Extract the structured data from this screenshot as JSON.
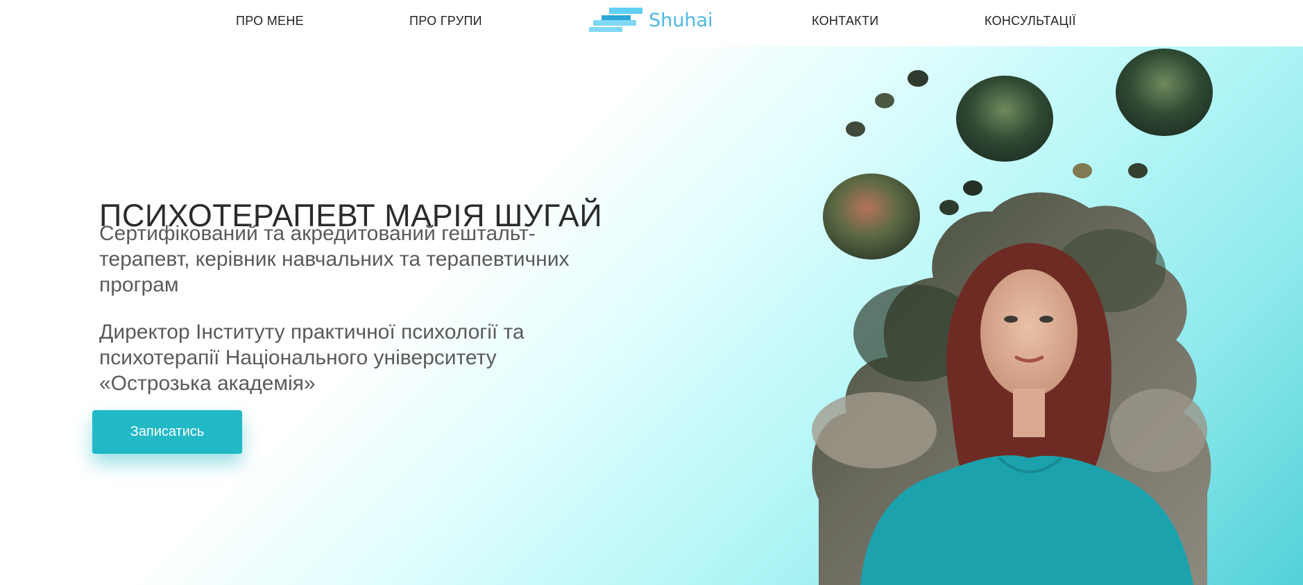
{
  "nav": {
    "items": [
      {
        "label": "ПРО МЕНЕ"
      },
      {
        "label": "ПРО ГРУПИ"
      },
      {
        "label": "КОНТАКТИ"
      },
      {
        "label": "КОНСУЛЬТАЦІЇ"
      }
    ],
    "logo_text": "Shuhai"
  },
  "hero": {
    "title": "ПСИХОТЕРАПЕВТ МАРІЯ ШУГАЙ",
    "lead": "Сертифікований та акредитований гештальт-терапевт, керівник навчальних та терапевтичних програм",
    "lead2": "Директор Інституту практичної психології та психотерапії Національного університету «Острозька академія»",
    "cta_label": "Записатись"
  },
  "colors": {
    "accent": "#22b9c6",
    "logo": "#4cb8e6",
    "gradient_end": "#52d1d8"
  },
  "icons": {
    "logo": "stacked-bars-logo-icon"
  }
}
